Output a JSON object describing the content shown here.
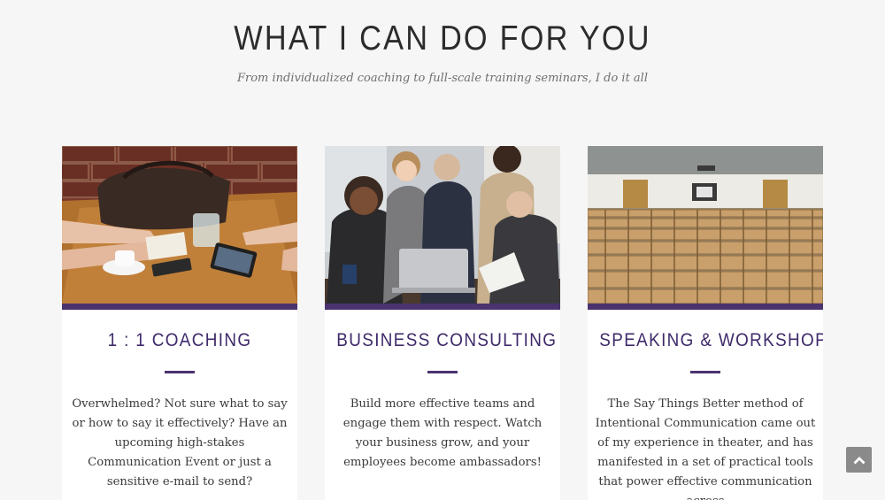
{
  "section": {
    "title": "WHAT I CAN DO FOR YOU",
    "subtitle": "From individualized coaching to full-scale training seminars, I do it all"
  },
  "cards": [
    {
      "title": "1 : 1 COACHING",
      "text": "Overwhelmed? Not sure what to say or how to say it effectively? Have an upcoming high-stakes Communication Event or just a sensitive e-mail to send?"
    },
    {
      "title": "BUSINESS CONSULTING",
      "text": "Build more effective teams and engage them with respect. Watch your business grow, and your employees become ambassadors!"
    },
    {
      "title": "SPEAKING & WORKSHOPS",
      "text": "The Say Things Better method of Intentional Communication came out of my experience in theater, and has manifested in a set of practical tools that power effective communication across"
    }
  ],
  "colors": {
    "accent": "#4a336f",
    "background": "#f6f6f6",
    "card": "#ffffff"
  },
  "icons": {
    "back_to_top": "chevron-up-icon"
  }
}
